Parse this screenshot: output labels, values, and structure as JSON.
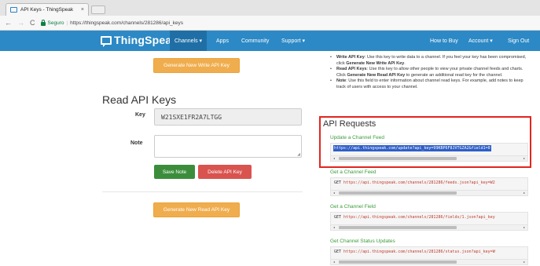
{
  "browser": {
    "tab_title": "API Keys - ThingSpeak",
    "tab_close": "×",
    "back": "←",
    "forward": "→",
    "reload": "C",
    "secure_label": "Seguro",
    "url_separator": "|",
    "url": "https://thingspeak.com/channels/281286/api_keys"
  },
  "navbar": {
    "brand": "ThingSpeak",
    "brand_tm": "™",
    "items": [
      {
        "label": "Channels ▾",
        "active": true
      },
      {
        "label": "Apps"
      },
      {
        "label": "Community"
      },
      {
        "label": "Support ▾"
      }
    ],
    "right_items": [
      {
        "label": "How to Buy"
      },
      {
        "label": "Account ▾"
      },
      {
        "label": "Sign Out"
      }
    ],
    "color": "#2c89c5"
  },
  "left": {
    "generate_write_button": "Generate New Write API Key",
    "section_title": "Read API Keys",
    "key_label": "Key",
    "key_value": "W21SXE1FR2A7LTGG",
    "note_label": "Note",
    "note_value": "",
    "save_button": "Save Note",
    "delete_button": "Delete API Key",
    "generate_read_button": "Generate New Read API Key"
  },
  "help": {
    "items": [
      {
        "bold": "Write API Key",
        "text": ": Use this key to write data to a channel. If you feel your key has been compromised, click ",
        "bold2": "Generate New Write API Key",
        "tail": "."
      },
      {
        "bold": "Read API Keys",
        "text": ": Use this key to allow other people to view your private channel feeds and charts. Click ",
        "bold2": "Generate New Read API Key",
        "tail": " to generate an additional read key for the channel."
      },
      {
        "bold": "Note",
        "text": ": Use this field to enter information about channel read keys. For example, add notes to keep track of users with access to your channel.",
        "bold2": "",
        "tail": ""
      }
    ]
  },
  "api": {
    "heading": "API Requests",
    "sections": [
      {
        "link": "Update a Channel Feed",
        "method": "",
        "url": "https://api.thingspeak.com/update?api_key=99KBP6F8JVTGZA2&field1=0",
        "selected": true
      },
      {
        "link": "Get a Channel Feed",
        "method": "GET",
        "url": "https://api.thingspeak.com/channels/281286/feeds.json?api_key=W2",
        "selected": false
      },
      {
        "link": "Get a Channel Field",
        "method": "GET",
        "url": "https://api.thingspeak.com/channels/281286/fields/1.json?api_key",
        "selected": false
      },
      {
        "link": "Get Channel Status Updates",
        "method": "GET",
        "url": "https://api.thingspeak.com/channels/281286/status.json?api_key=W",
        "selected": false
      }
    ],
    "scroll_left": "◂",
    "scroll_right": "▸",
    "highlight_color": "#e2251f"
  }
}
